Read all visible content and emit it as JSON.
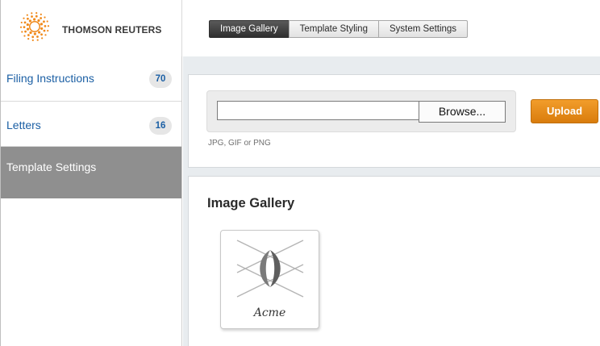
{
  "brand": {
    "name": "THOMSON REUTERS",
    "logo_icon": "thomson-reuters-sunburst-logo",
    "logo_color": "#f08a1c"
  },
  "top_nav": {
    "tabs": [
      {
        "label": "Image Gallery",
        "active": true
      },
      {
        "label": "Template Styling",
        "active": false
      },
      {
        "label": "System Settings",
        "active": false
      }
    ]
  },
  "sidebar": {
    "items": [
      {
        "label": "Filing Instructions",
        "count": "70"
      },
      {
        "label": "Letters",
        "count": "16"
      },
      {
        "label": "Template Settings",
        "active": true
      }
    ]
  },
  "upload": {
    "file_value": "",
    "browse_label": "Browse...",
    "hint": "JPG, GIF or PNG",
    "upload_label": "Upload",
    "upload_color": "#e5890f"
  },
  "gallery": {
    "title": "Image Gallery",
    "images": [
      {
        "caption": "Acme",
        "icon": "acme-logo-thumbnail"
      }
    ]
  }
}
